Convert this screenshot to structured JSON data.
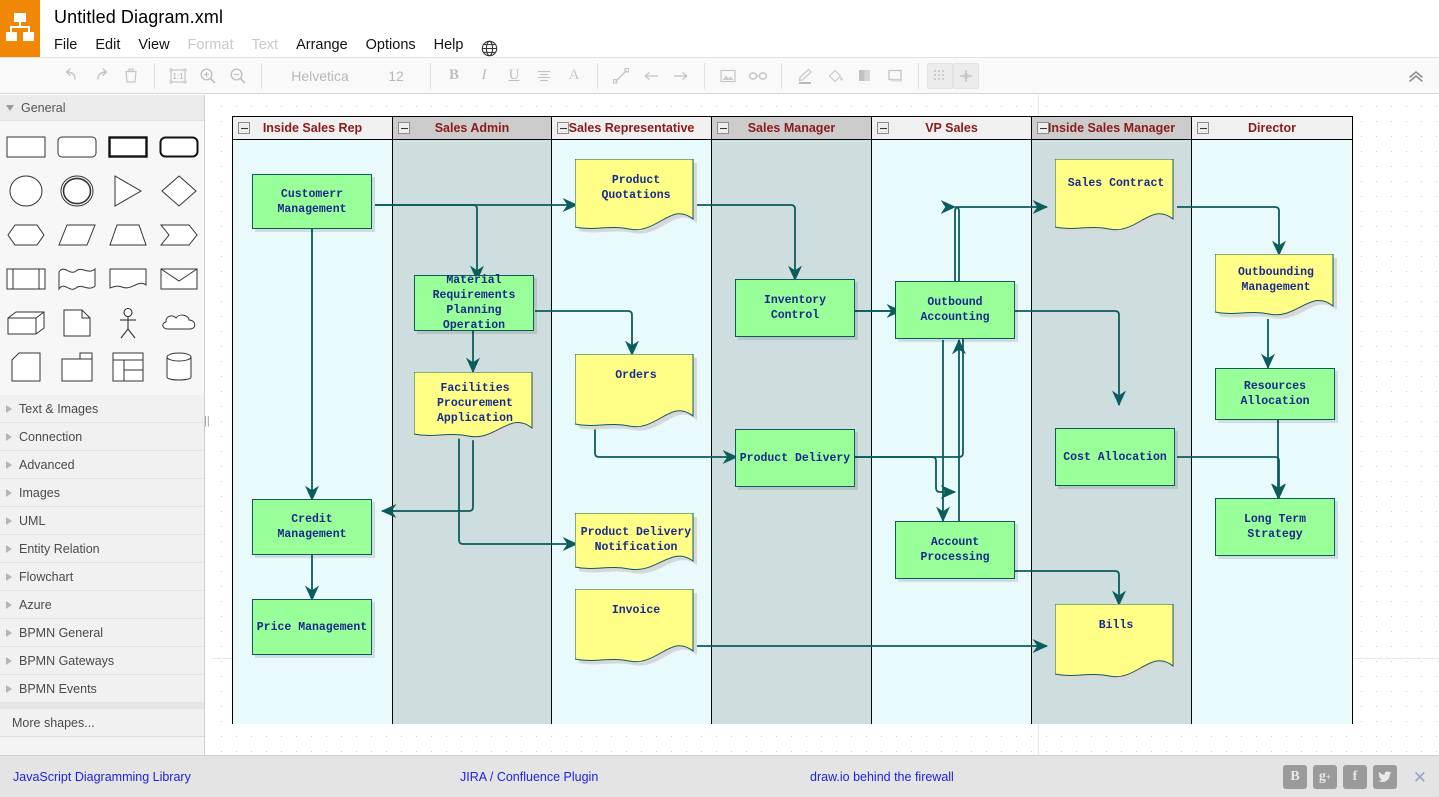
{
  "app": {
    "title": "Untitled Diagram.xml",
    "logo_icon": "drawio-logo-icon",
    "collapse_toolbar_icon": "chevron-double-up-icon"
  },
  "menubar": {
    "items": [
      {
        "label": "File",
        "disabled": false
      },
      {
        "label": "Edit",
        "disabled": false
      },
      {
        "label": "View",
        "disabled": false
      },
      {
        "label": "Format",
        "disabled": true
      },
      {
        "label": "Text",
        "disabled": true
      },
      {
        "label": "Arrange",
        "disabled": false
      },
      {
        "label": "Options",
        "disabled": false
      },
      {
        "label": "Help",
        "disabled": false
      }
    ],
    "language_icon": "globe-icon"
  },
  "toolbar": {
    "font_name": "Helvetica",
    "font_size": "12",
    "buttons": [
      "undo-icon",
      "redo-icon",
      "delete-icon",
      "zoom-actual-icon",
      "zoom-in-icon",
      "zoom-out-icon",
      "bold-icon",
      "italic-icon",
      "underline-icon",
      "align-icon",
      "font-color-icon",
      "line-icon",
      "arrow-left-icon",
      "arrow-right-icon",
      "image-icon",
      "link-icon",
      "line-color-icon",
      "fill-color-icon",
      "shadow-icon",
      "outline-icon",
      "grid-icon",
      "waypoints-icon"
    ]
  },
  "sidebar": {
    "open_section": "General",
    "shapes": [
      "rectangle-shape",
      "rounded-rectangle-shape",
      "thick-rectangle-shape",
      "pill-rectangle-shape",
      "ellipse-shape",
      "double-ellipse-shape",
      "triangle-shape",
      "rhombus-shape",
      "hexagon-shape",
      "parallelogram-shape",
      "trapezoid-shape",
      "step-shape",
      "process-shape",
      "double-wave-shape",
      "document-shape",
      "envelope-shape",
      "cube-shape",
      "note-shape",
      "actor-shape",
      "cloud-shape",
      "card-shape",
      "tape-shape",
      "table-shape",
      "cylinder-shape"
    ],
    "categories": [
      "Text & Images",
      "Connection",
      "Advanced",
      "Images",
      "UML",
      "Entity Relation",
      "Flowchart",
      "Azure",
      "BPMN General",
      "BPMN Gateways",
      "BPMN Events"
    ],
    "more_shapes": "More shapes..."
  },
  "diagram": {
    "lanes": [
      {
        "title": "Inside Sales Rep",
        "fill": "#e8fafc"
      },
      {
        "title": "Sales Admin",
        "fill": "#cedede"
      },
      {
        "title": "Sales Representative",
        "fill": "#e8fafc"
      },
      {
        "title": "Sales Manager",
        "fill": "#cedede"
      },
      {
        "title": "VP Sales",
        "fill": "#e8fafc"
      },
      {
        "title": "Inside Sales Manager",
        "fill": "#cedede"
      },
      {
        "title": "Director",
        "fill": "#e8fafc"
      }
    ],
    "lane_header_fill_light": "#f0f0f0",
    "lane_header_fill_dark": "#cccccc",
    "lane_title_color": "#8b1a1a",
    "node_process_fill": "#99ff99",
    "node_document_fill": "#ffff88",
    "node_border_color": "#0d5c5c",
    "node_text_color": "#1a2a8a",
    "edge_color": "#0d5c5c",
    "nodes": [
      {
        "id": "customerr-management",
        "label": "Customerr\nManagement",
        "lane": 0,
        "type": "process"
      },
      {
        "id": "credit-management",
        "label": "Credit\nManagement",
        "lane": 0,
        "type": "process"
      },
      {
        "id": "price-management",
        "label": "Price Management",
        "lane": 0,
        "type": "process"
      },
      {
        "id": "material-requirements-planning-operation",
        "label": "Material\nRequirements\nPlanning\nOperation",
        "lane": 1,
        "type": "process"
      },
      {
        "id": "facilities-procurement-application",
        "label": "Facilities\nProcurement\nApplication",
        "lane": 1,
        "type": "document"
      },
      {
        "id": "product-quotations",
        "label": "Product\nQuotations",
        "lane": 2,
        "type": "document"
      },
      {
        "id": "orders",
        "label": "Orders",
        "lane": 2,
        "type": "document"
      },
      {
        "id": "product-delivery-notification",
        "label": "Product Delivery\nNotification",
        "lane": 2,
        "type": "document"
      },
      {
        "id": "invoice",
        "label": "Invoice",
        "lane": 2,
        "type": "document"
      },
      {
        "id": "inventory-control",
        "label": "Inventory\nControl",
        "lane": 3,
        "type": "process"
      },
      {
        "id": "product-delivery",
        "label": "Product Delivery",
        "lane": 3,
        "type": "process"
      },
      {
        "id": "outbound-accounting",
        "label": "Outbound\nAccounting",
        "lane": 4,
        "type": "process"
      },
      {
        "id": "account-processing",
        "label": "Account\nProcessing",
        "lane": 4,
        "type": "process"
      },
      {
        "id": "sales-contract",
        "label": "Sales Contract",
        "lane": 5,
        "type": "document"
      },
      {
        "id": "cost-allocation",
        "label": "Cost Allocation",
        "lane": 5,
        "type": "process"
      },
      {
        "id": "bills",
        "label": "Bills",
        "lane": 5,
        "type": "document"
      },
      {
        "id": "outbounding-management",
        "label": "Outbounding\nManagement",
        "lane": 6,
        "type": "document"
      },
      {
        "id": "resources-allocation",
        "label": "Resources\nAllocation",
        "lane": 6,
        "type": "process"
      },
      {
        "id": "long-term-strategy",
        "label": "Long Term\nStrategy",
        "lane": 6,
        "type": "process"
      }
    ]
  },
  "footer": {
    "links": [
      {
        "label": "JavaScript Diagramming Library"
      },
      {
        "label": "JIRA / Confluence Plugin"
      },
      {
        "label": "draw.io behind the firewall"
      }
    ],
    "social": [
      "blogger-icon",
      "googleplus-icon",
      "facebook-icon",
      "twitter-icon"
    ],
    "close_icon": "close-icon"
  }
}
